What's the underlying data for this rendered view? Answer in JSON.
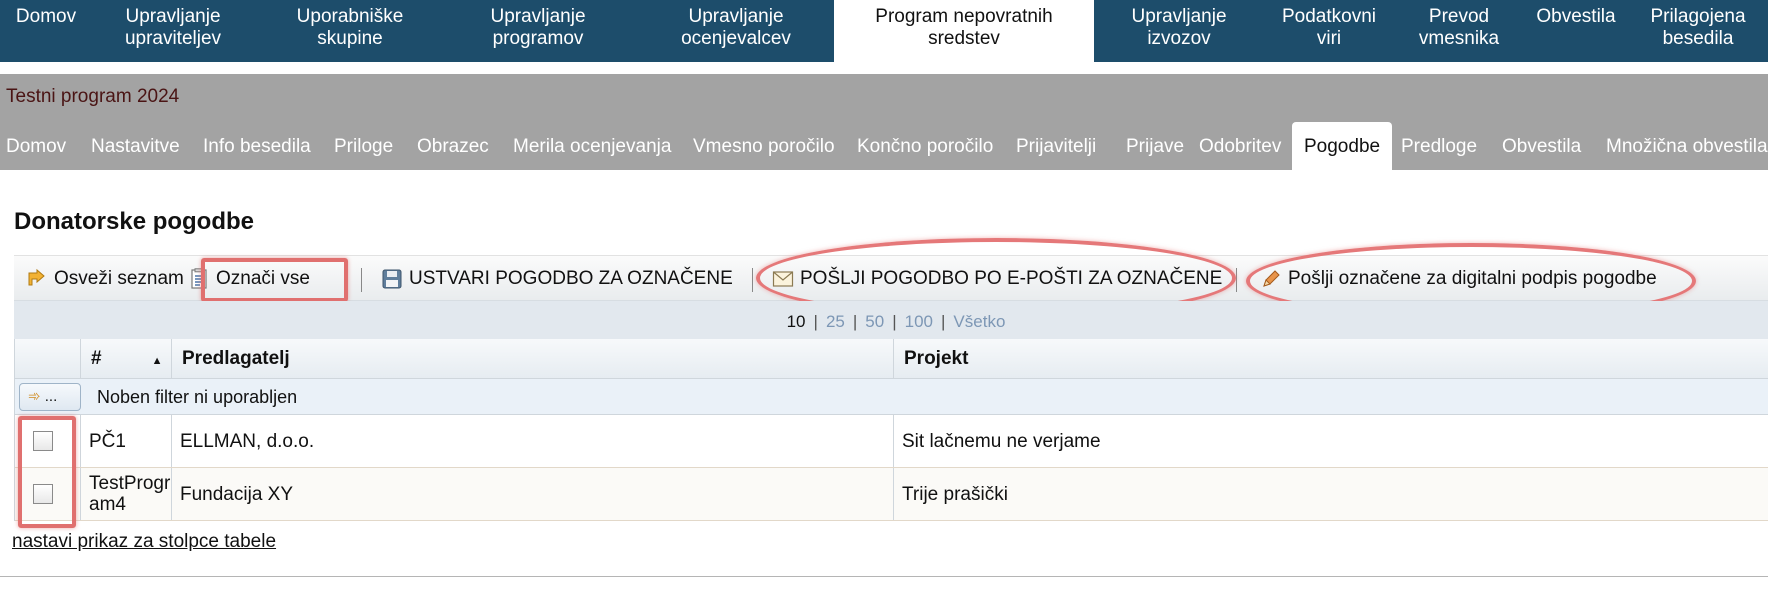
{
  "topnav": {
    "items": [
      {
        "l1": "Domov",
        "l2": ""
      },
      {
        "l1": "Upravljanje",
        "l2": "upraviteljev"
      },
      {
        "l1": "Uporabniške",
        "l2": "skupine"
      },
      {
        "l1": "Upravljanje",
        "l2": "programov"
      },
      {
        "l1": "Upravljanje",
        "l2": "ocenjevalcev"
      },
      {
        "l1": "Program nepovratnih",
        "l2": "sredstev"
      },
      {
        "l1": "Upravljanje",
        "l2": "izvozov"
      },
      {
        "l1": "Podatkovni",
        "l2": "viri"
      },
      {
        "l1": "Prevod",
        "l2": "vmesnika"
      },
      {
        "l1": "Obvestila",
        "l2": ""
      },
      {
        "l1": "Prilagojena",
        "l2": "besedila"
      }
    ]
  },
  "program": {
    "title": "Testni program 2024",
    "tabs": [
      "Domov",
      "Nastavitve",
      "Info besedila",
      "Priloge",
      "Obrazec",
      "Merila ocenjevanja",
      "Vmesno poročilo",
      "Končno poročilo",
      "Prijavitelji",
      "Prijave",
      "Odobritev",
      "Pogodbe",
      "Predloge",
      "Obvestila",
      "Množična obvestila"
    ],
    "active_tab": "Pogodbe"
  },
  "page": {
    "title": "Donatorske pogodbe"
  },
  "toolbar": {
    "refresh": "Osveži seznam",
    "select_all": "Označi vse",
    "create": "USTVARI POGODBO ZA OZNAČENE",
    "email": "POŠLJI POGODBO PO E-POŠTI ZA OZNAČENE",
    "sign": "Pošlji označene za digitalni podpis pogodbe"
  },
  "pager": {
    "sizes": [
      "10",
      "25",
      "50",
      "100",
      "Všetko"
    ],
    "current": "10"
  },
  "grid": {
    "columns": {
      "num": "#",
      "proposer": "Predlagatelj",
      "project": "Projekt"
    },
    "filter_button": "...",
    "filter_text": "Noben filter ni uporabljen",
    "rows": [
      {
        "num": "PČ1",
        "proposer": "ELLMAN, d.o.o.",
        "project": "Sit lačnemu ne verjame"
      },
      {
        "num": "TestProgram4",
        "num_l1": "TestProgr",
        "num_l2": "am4",
        "proposer": "Fundacija XY",
        "project": "Trije prašički"
      }
    ]
  },
  "footer": {
    "columns_link": "nastavi prikaz za stolpce tabele"
  },
  "colors": {
    "nav_bg": "#1d4d6b",
    "band_bg": "#a3a3a3",
    "highlight": "#e0706f",
    "pager_bg": "#e2e8ee"
  }
}
